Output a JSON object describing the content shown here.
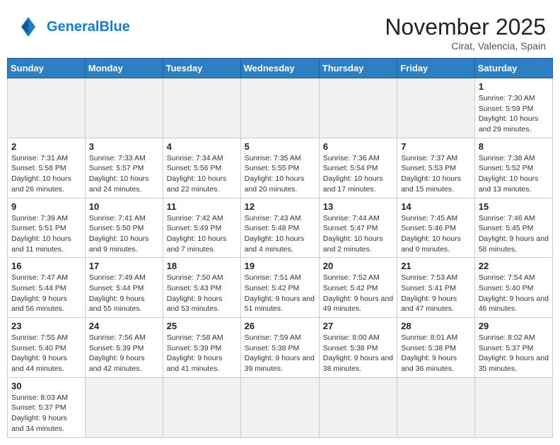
{
  "header": {
    "logo_general": "General",
    "logo_blue": "Blue",
    "month_title": "November 2025",
    "location": "Cirat, Valencia, Spain"
  },
  "weekdays": [
    "Sunday",
    "Monday",
    "Tuesday",
    "Wednesday",
    "Thursday",
    "Friday",
    "Saturday"
  ],
  "weeks": [
    [
      {
        "day": "",
        "info": "",
        "empty": true
      },
      {
        "day": "",
        "info": "",
        "empty": true
      },
      {
        "day": "",
        "info": "",
        "empty": true
      },
      {
        "day": "",
        "info": "",
        "empty": true
      },
      {
        "day": "",
        "info": "",
        "empty": true
      },
      {
        "day": "",
        "info": "",
        "empty": true
      },
      {
        "day": "1",
        "info": "Sunrise: 7:30 AM\nSunset: 5:59 PM\nDaylight: 10 hours and 29 minutes."
      }
    ],
    [
      {
        "day": "2",
        "info": "Sunrise: 7:31 AM\nSunset: 5:58 PM\nDaylight: 10 hours and 26 minutes."
      },
      {
        "day": "3",
        "info": "Sunrise: 7:33 AM\nSunset: 5:57 PM\nDaylight: 10 hours and 24 minutes."
      },
      {
        "day": "4",
        "info": "Sunrise: 7:34 AM\nSunset: 5:56 PM\nDaylight: 10 hours and 22 minutes."
      },
      {
        "day": "5",
        "info": "Sunrise: 7:35 AM\nSunset: 5:55 PM\nDaylight: 10 hours and 20 minutes."
      },
      {
        "day": "6",
        "info": "Sunrise: 7:36 AM\nSunset: 5:54 PM\nDaylight: 10 hours and 17 minutes."
      },
      {
        "day": "7",
        "info": "Sunrise: 7:37 AM\nSunset: 5:53 PM\nDaylight: 10 hours and 15 minutes."
      },
      {
        "day": "8",
        "info": "Sunrise: 7:38 AM\nSunset: 5:52 PM\nDaylight: 10 hours and 13 minutes."
      }
    ],
    [
      {
        "day": "9",
        "info": "Sunrise: 7:39 AM\nSunset: 5:51 PM\nDaylight: 10 hours and 11 minutes."
      },
      {
        "day": "10",
        "info": "Sunrise: 7:41 AM\nSunset: 5:50 PM\nDaylight: 10 hours and 9 minutes."
      },
      {
        "day": "11",
        "info": "Sunrise: 7:42 AM\nSunset: 5:49 PM\nDaylight: 10 hours and 7 minutes."
      },
      {
        "day": "12",
        "info": "Sunrise: 7:43 AM\nSunset: 5:48 PM\nDaylight: 10 hours and 4 minutes."
      },
      {
        "day": "13",
        "info": "Sunrise: 7:44 AM\nSunset: 5:47 PM\nDaylight: 10 hours and 2 minutes."
      },
      {
        "day": "14",
        "info": "Sunrise: 7:45 AM\nSunset: 5:46 PM\nDaylight: 10 hours and 0 minutes."
      },
      {
        "day": "15",
        "info": "Sunrise: 7:46 AM\nSunset: 5:45 PM\nDaylight: 9 hours and 58 minutes."
      }
    ],
    [
      {
        "day": "16",
        "info": "Sunrise: 7:47 AM\nSunset: 5:44 PM\nDaylight: 9 hours and 56 minutes."
      },
      {
        "day": "17",
        "info": "Sunrise: 7:49 AM\nSunset: 5:44 PM\nDaylight: 9 hours and 55 minutes."
      },
      {
        "day": "18",
        "info": "Sunrise: 7:50 AM\nSunset: 5:43 PM\nDaylight: 9 hours and 53 minutes."
      },
      {
        "day": "19",
        "info": "Sunrise: 7:51 AM\nSunset: 5:42 PM\nDaylight: 9 hours and 51 minutes."
      },
      {
        "day": "20",
        "info": "Sunrise: 7:52 AM\nSunset: 5:42 PM\nDaylight: 9 hours and 49 minutes."
      },
      {
        "day": "21",
        "info": "Sunrise: 7:53 AM\nSunset: 5:41 PM\nDaylight: 9 hours and 47 minutes."
      },
      {
        "day": "22",
        "info": "Sunrise: 7:54 AM\nSunset: 5:40 PM\nDaylight: 9 hours and 46 minutes."
      }
    ],
    [
      {
        "day": "23",
        "info": "Sunrise: 7:55 AM\nSunset: 5:40 PM\nDaylight: 9 hours and 44 minutes."
      },
      {
        "day": "24",
        "info": "Sunrise: 7:56 AM\nSunset: 5:39 PM\nDaylight: 9 hours and 42 minutes."
      },
      {
        "day": "25",
        "info": "Sunrise: 7:58 AM\nSunset: 5:39 PM\nDaylight: 9 hours and 41 minutes."
      },
      {
        "day": "26",
        "info": "Sunrise: 7:59 AM\nSunset: 5:38 PM\nDaylight: 9 hours and 39 minutes."
      },
      {
        "day": "27",
        "info": "Sunrise: 8:00 AM\nSunset: 5:38 PM\nDaylight: 9 hours and 38 minutes."
      },
      {
        "day": "28",
        "info": "Sunrise: 8:01 AM\nSunset: 5:38 PM\nDaylight: 9 hours and 36 minutes."
      },
      {
        "day": "29",
        "info": "Sunrise: 8:02 AM\nSunset: 5:37 PM\nDaylight: 9 hours and 35 minutes."
      }
    ],
    [
      {
        "day": "30",
        "info": "Sunrise: 8:03 AM\nSunset: 5:37 PM\nDaylight: 9 hours and 34 minutes."
      },
      {
        "day": "",
        "info": "",
        "empty": true
      },
      {
        "day": "",
        "info": "",
        "empty": true
      },
      {
        "day": "",
        "info": "",
        "empty": true
      },
      {
        "day": "",
        "info": "",
        "empty": true
      },
      {
        "day": "",
        "info": "",
        "empty": true
      },
      {
        "day": "",
        "info": "",
        "empty": true
      }
    ]
  ]
}
